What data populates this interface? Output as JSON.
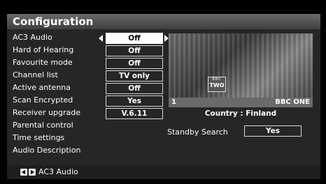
{
  "title": "Configuration",
  "menu": [
    {
      "label": "AC3 Audio",
      "value": "Off",
      "selected": true
    },
    {
      "label": "Hard of Hearing",
      "value": "Off"
    },
    {
      "label": "Favourite mode",
      "value": "Off"
    },
    {
      "label": "Channel list",
      "value": "TV only"
    },
    {
      "label": "Active antenna",
      "value": "Off"
    },
    {
      "label": "Scan Encrypted",
      "value": "Yes"
    },
    {
      "label": "Receiver upgrade",
      "value": "V.6.11"
    },
    {
      "label": "Parental control"
    },
    {
      "label": "Time settings"
    },
    {
      "label": "Audio Description"
    }
  ],
  "preview": {
    "logo_top": "BBC",
    "logo_bottom": "TWO",
    "channel_number": "1",
    "channel_name": "BBC ONE",
    "country": "Country : Finland"
  },
  "standby": {
    "label": "Standby Search",
    "value": "Yes"
  },
  "footer": {
    "hint": "AC3 Audio"
  }
}
